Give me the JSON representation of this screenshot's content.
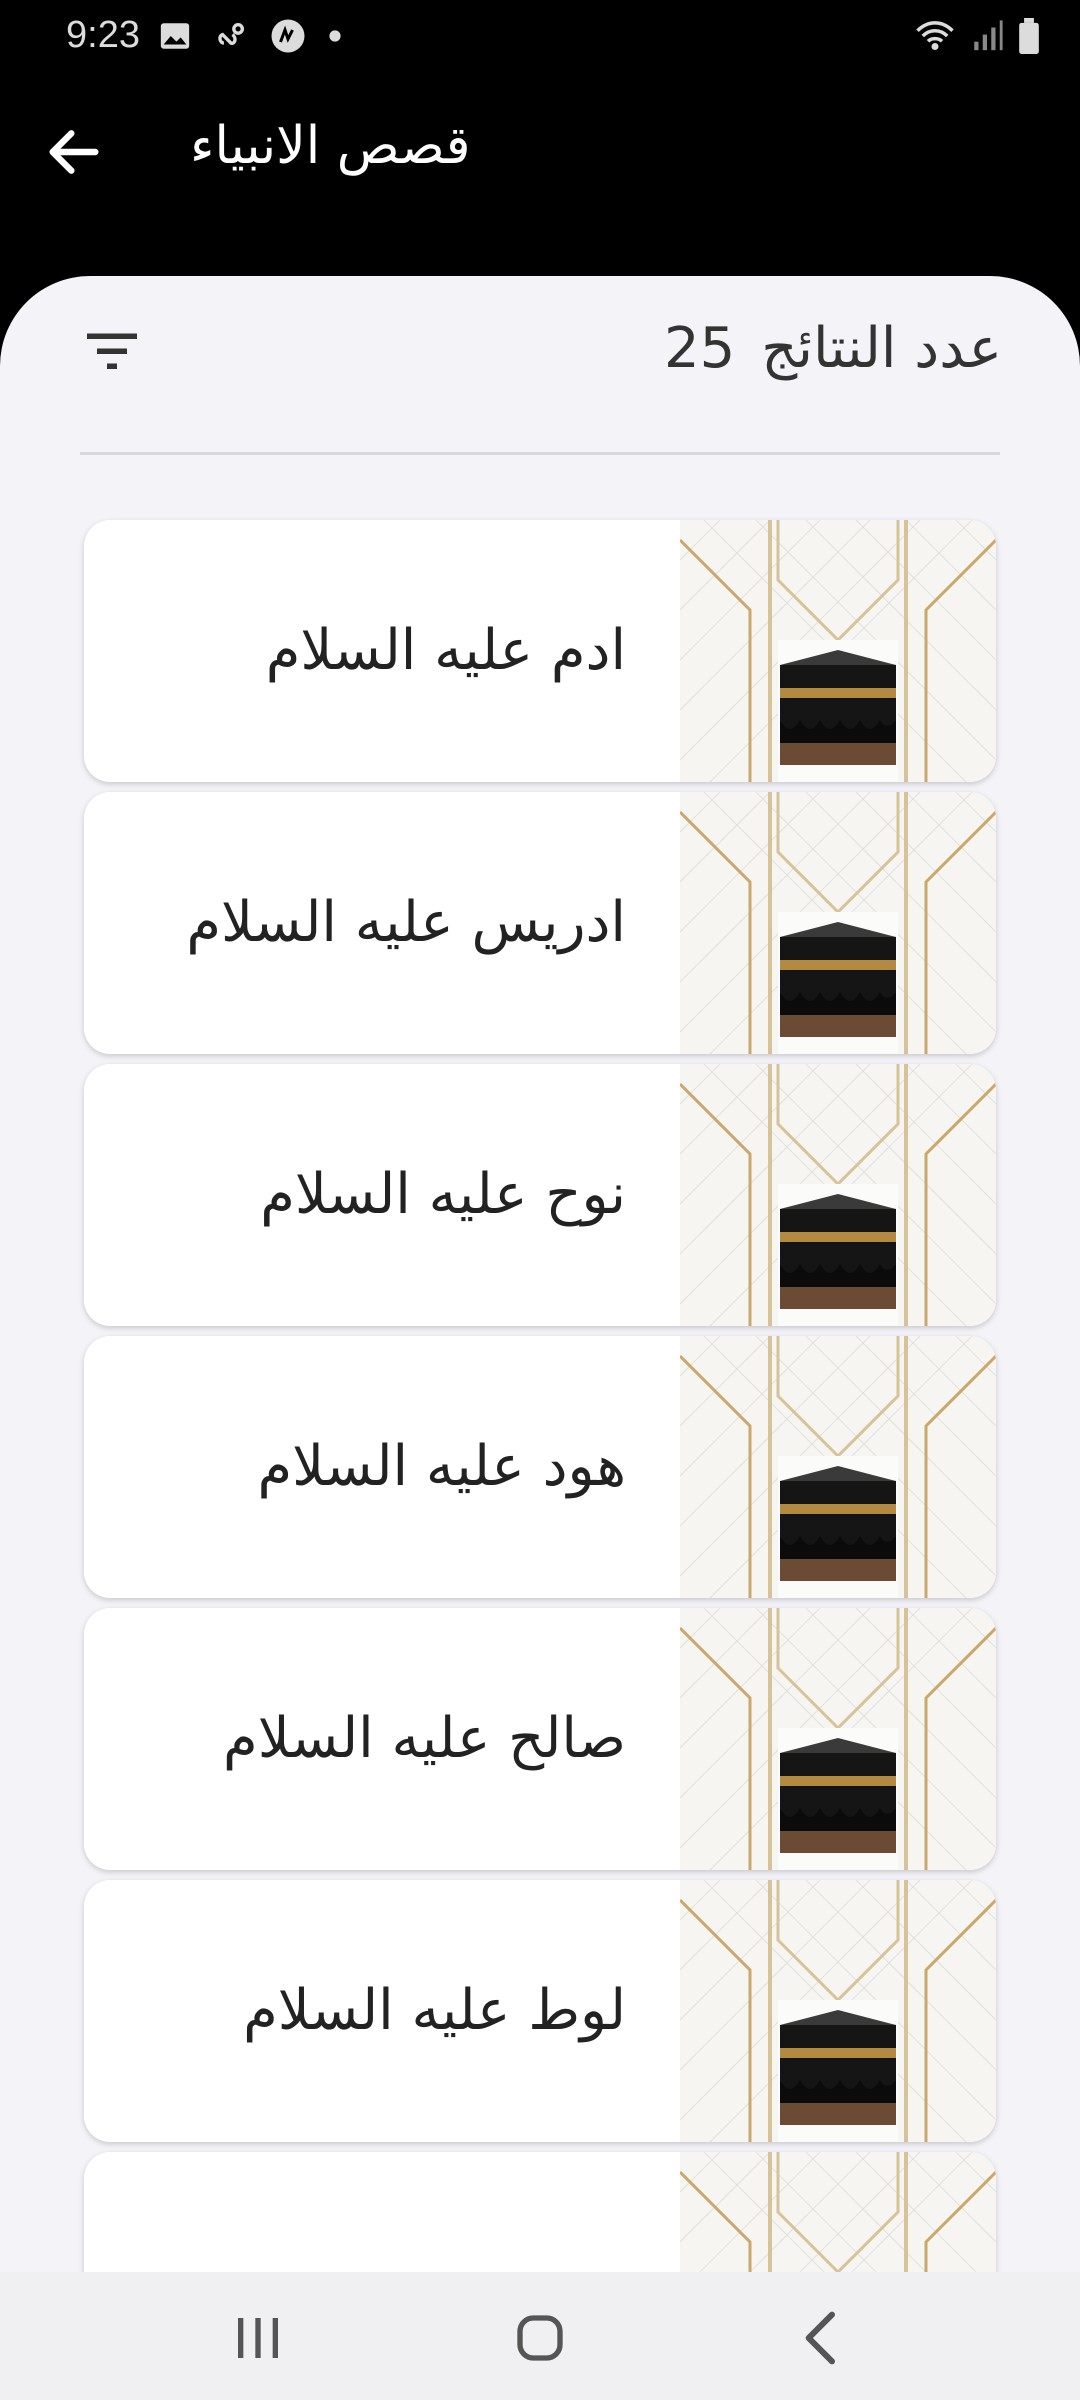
{
  "status_bar": {
    "time": "9:23",
    "icons_left": [
      "image-icon",
      "link-icon",
      "app-icon",
      "dot-icon"
    ],
    "icons_right": [
      "wifi-icon",
      "signal-icon",
      "battery-icon"
    ]
  },
  "app_bar": {
    "title": "قصص الانبياء"
  },
  "results": {
    "label": "عدد النتائج",
    "count": "25"
  },
  "items": [
    {
      "title": "ادم عليه السلام"
    },
    {
      "title": "ادريس عليه السلام"
    },
    {
      "title": "نوح عليه السلام"
    },
    {
      "title": "هود عليه السلام"
    },
    {
      "title": "صالح عليه السلام"
    },
    {
      "title": "لوط  عليه السلام"
    },
    {
      "title": ""
    }
  ],
  "colors": {
    "app_bar_bg": "#000000",
    "sheet_bg": "#f3f3f8",
    "card_bg": "#ffffff",
    "gold": "#c9a464"
  }
}
